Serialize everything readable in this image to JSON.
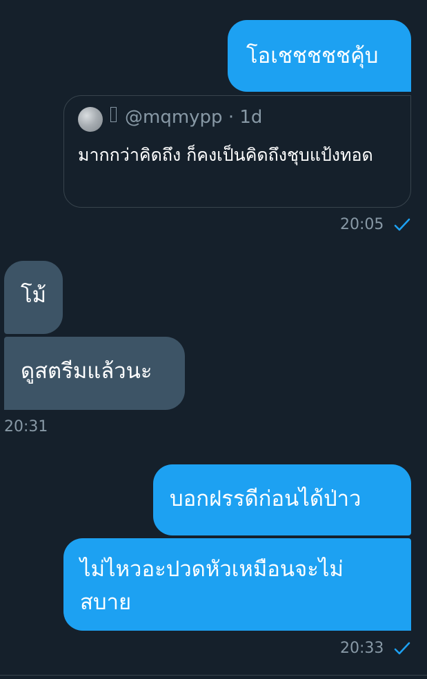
{
  "messages": {
    "m1": "โอเชชชชชคุ้บ",
    "quote_handle": "@mqmypp · 1d",
    "quote_text": "มากกว่าคิดถึง ก็คงเป็นคิดถึงชุบแป้งทอด",
    "time1": "20:05",
    "m2": "โม้",
    "m3": "ดูสตรีมแล้วนะ",
    "time2": "20:31",
    "m4": "บอกฝรรดีก่อนได้ป่าว",
    "m5": "ไม่ไหวอะปวดหัวเหมือนจะไม่สบาย",
    "time3": "20:33"
  },
  "colors": {
    "background": "#15202b",
    "sent_bubble": "#1da1f2",
    "received_bubble": "#3d5466",
    "meta_text": "#8899a6",
    "check": "#1da1f2"
  },
  "icons": {
    "sent_status": "check-icon"
  }
}
